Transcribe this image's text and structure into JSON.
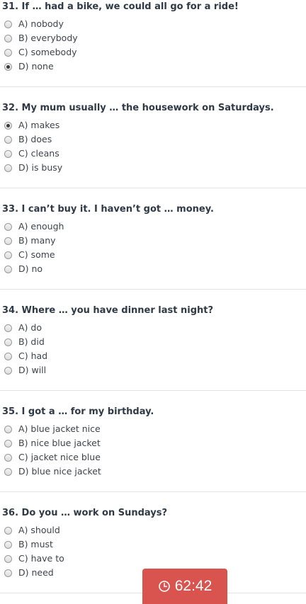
{
  "questions": [
    {
      "title": "31. If … had a bike, we could all go for a ride!",
      "options": [
        "A) nobody",
        "B) everybody",
        "C) somebody",
        "D) none"
      ],
      "selected_index": 3
    },
    {
      "title": "32. My mum usually … the housework on Saturdays.",
      "options": [
        "A) makes",
        "B) does",
        "C) cleans",
        "D) is busy"
      ],
      "selected_index": 0
    },
    {
      "title": "33. I can’t buy it. I haven’t got … money.",
      "options": [
        "A) enough",
        "B) many",
        "C) some",
        "D) no"
      ],
      "selected_index": null
    },
    {
      "title": "34. Where … you have dinner last night?",
      "options": [
        "A) do",
        "B) did",
        "C) had",
        "D) will"
      ],
      "selected_index": null
    },
    {
      "title": "35. I got a … for my birthday.",
      "options": [
        "A) blue jacket nice",
        "B) nice blue jacket",
        "C) jacket nice blue",
        "D) blue nice jacket"
      ],
      "selected_index": null
    },
    {
      "title": "36. Do you … work on Sundays?",
      "options": [
        "A) should",
        "B) must",
        "C) have to",
        "D) need"
      ],
      "selected_index": null
    }
  ],
  "timer": {
    "icon": "clock-icon",
    "text": "62:42",
    "color": "#d9534f"
  }
}
